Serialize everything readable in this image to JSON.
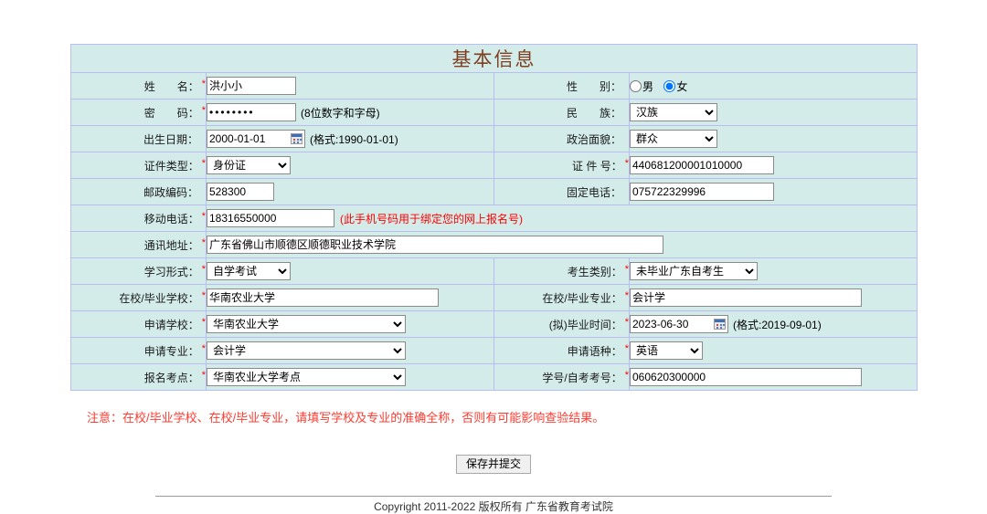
{
  "form": {
    "title": "基本信息",
    "rows": {
      "name": {
        "label": "姓　　名：",
        "required": true,
        "value": "洪小小"
      },
      "gender": {
        "label": "性　　别：",
        "required": false,
        "options": [
          "男",
          "女"
        ],
        "selected": "女"
      },
      "password": {
        "label": "密　　码：",
        "required": true,
        "value": "••••••••",
        "hint": "(8位数字和字母)"
      },
      "nation": {
        "label": "民　　族：",
        "required": false,
        "selected": "汉族"
      },
      "birthdate": {
        "label": "出生日期：",
        "required": false,
        "value": "2000-01-01",
        "hint": "(格式:1990-01-01)",
        "icon": "calendar-icon"
      },
      "political": {
        "label": "政治面貌：",
        "required": false,
        "selected": "群众"
      },
      "id_type": {
        "label": "证件类型：",
        "required": true,
        "selected": "身份证"
      },
      "id_number": {
        "label": "证 件 号：",
        "required": true,
        "value": "440681200001010000"
      },
      "zipcode": {
        "label": "邮政编码：",
        "required": false,
        "value": "528300"
      },
      "telephone": {
        "label": "固定电话：",
        "required": false,
        "value": "075722329996"
      },
      "mobile": {
        "label": "移动电话：",
        "required": true,
        "value": "18316550000",
        "hint": "(此手机号码用于绑定您的网上报名号)"
      },
      "address": {
        "label": "通讯地址：",
        "required": true,
        "value": "广东省佛山市顺德区顺德职业技术学院"
      },
      "study_form": {
        "label": "学习形式：",
        "required": true,
        "selected": "自学考试"
      },
      "candidate_type": {
        "label": "考生类别：",
        "required": true,
        "selected": "未毕业广东自考生"
      },
      "school": {
        "label": "在校/毕业学校：",
        "required": true,
        "value": "华南农业大学"
      },
      "major": {
        "label": "在校/毕业专业：",
        "required": true,
        "value": "会计学"
      },
      "apply_school": {
        "label": "申请学校：",
        "required": true,
        "selected": "华南农业大学"
      },
      "graduation_date": {
        "label": "(拟)毕业时间：",
        "required": true,
        "value": "2023-06-30",
        "hint": "(格式:2019-09-01)",
        "icon": "calendar-icon"
      },
      "apply_major": {
        "label": "申请专业：",
        "required": true,
        "selected": "会计学"
      },
      "apply_language": {
        "label": "申请语种：",
        "required": true,
        "selected": "英语"
      },
      "exam_site": {
        "label": "报名考点：",
        "required": true,
        "selected": "华南农业大学考点"
      },
      "student_number": {
        "label": "学号/自考考号：",
        "required": true,
        "value": "060620300000"
      }
    }
  },
  "notice": "注意：在校/毕业学校、在校/毕业专业，请填写学校及专业的准确全称，否则有可能影响查验结果。",
  "submit": {
    "label": "保存并提交"
  },
  "footer": {
    "text": "Copyright 2011-2022 版权所有  广东省教育考试院"
  },
  "colors": {
    "cell_background": "#d3ecea",
    "cell_border": "#b9bdf0",
    "table_border": "#9a9ad0",
    "title_text": "#7d3f20",
    "required_star": "#ff0000",
    "notice_text": "#ff3b30",
    "page_background": "#ffffff"
  }
}
